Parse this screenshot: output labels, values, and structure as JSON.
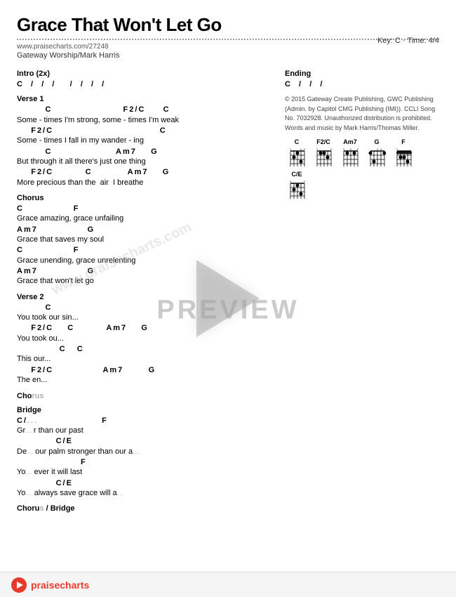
{
  "title": "Grace That Won't Let Go",
  "url": "www.praisecharts.com/27248",
  "artist": "Gateway Worship/Mark Harris",
  "key_time": "Key: C · Time: 4/4",
  "sections": {
    "intro": {
      "label": "Intro (2x)",
      "chord_line": "C  /  /  /    /  /  /  /"
    },
    "ending": {
      "label": "Ending",
      "chord_line": "C  /  /  /"
    },
    "verse1": {
      "label": "Verse 1",
      "lines": [
        {
          "type": "chord",
          "text": "        C                    F2/C     C"
        },
        {
          "type": "lyric",
          "text": "Some - times I'm strong, some - times I'm weak"
        },
        {
          "type": "chord",
          "text": "    F2/C                              C"
        },
        {
          "type": "lyric",
          "text": "Some - times I fall in my wander - ing"
        },
        {
          "type": "chord",
          "text": "        C                  Am7    G"
        },
        {
          "type": "lyric",
          "text": "But through it all there's just one thing"
        },
        {
          "type": "chord",
          "text": "    F2/C         C          Am7    G"
        },
        {
          "type": "lyric",
          "text": "More precious than the  air  I breathe"
        }
      ]
    },
    "chorus": {
      "label": "Chorus",
      "lines": [
        {
          "type": "chord",
          "text": "C              F"
        },
        {
          "type": "lyric",
          "text": "Grace amazing, grace unfailing"
        },
        {
          "type": "chord",
          "text": "Am7              G"
        },
        {
          "type": "lyric",
          "text": "Grace that saves my soul"
        },
        {
          "type": "chord",
          "text": "C              F"
        },
        {
          "type": "lyric",
          "text": "Grace unending, grace unrelenting"
        },
        {
          "type": "chord",
          "text": "Am7              G"
        },
        {
          "type": "lyric",
          "text": "Grace that won't let go"
        }
      ]
    },
    "verse2": {
      "label": "Verse 2",
      "lines": [
        {
          "type": "chord",
          "text": "        C"
        },
        {
          "type": "lyric",
          "text": "You took our sin..."
        },
        {
          "type": "chord",
          "text": "    F2/C    C         Am7    G"
        },
        {
          "type": "lyric",
          "text": "You took our..."
        },
        {
          "type": "chord",
          "text": "            C   C"
        },
        {
          "type": "lyric",
          "text": "This our..."
        },
        {
          "type": "chord",
          "text": "    F2/C              Am7       G"
        },
        {
          "type": "lyric",
          "text": "The en..."
        }
      ]
    },
    "chorus2": {
      "label": "Cho..."
    },
    "bridge": {
      "label": "Bridge",
      "lines": [
        {
          "type": "chord",
          "text": "C/..."
        },
        {
          "type": "lyric",
          "text": "Gr... r than our past"
        },
        {
          "type": "chord",
          "text": "           C/E"
        },
        {
          "type": "lyric",
          "text": "De... our palm stronger than our a..."
        },
        {
          "type": "chord",
          "text": "                  F"
        },
        {
          "type": "lyric",
          "text": "Yo... ever it will last"
        },
        {
          "type": "chord",
          "text": "           C/E"
        },
        {
          "type": "lyric",
          "text": "Yo... always save grace will a..."
        }
      ]
    },
    "chorus_bridge": {
      "label": "Chorus / Bridge"
    }
  },
  "copyright": "© 2015 Gateway Create Publishing, GWC Publishing (Admin. by Capitol CMG Publishing (IMI)). CCLI Song No. 7032928. Unauthorized distribution is prohibited. Words and music by Mark Harris/Thomas Miller.",
  "chord_diagrams": [
    {
      "name": "C"
    },
    {
      "name": "F2/C"
    },
    {
      "name": "Am7"
    },
    {
      "name": "G"
    },
    {
      "name": "F"
    },
    {
      "name": "C/E"
    }
  ],
  "preview_label": "PREVIEW",
  "watermark": "www.praisecharts.com",
  "logo_text_pre": "pr",
  "logo_text_red": "ai",
  "logo_text_post": "secharts"
}
